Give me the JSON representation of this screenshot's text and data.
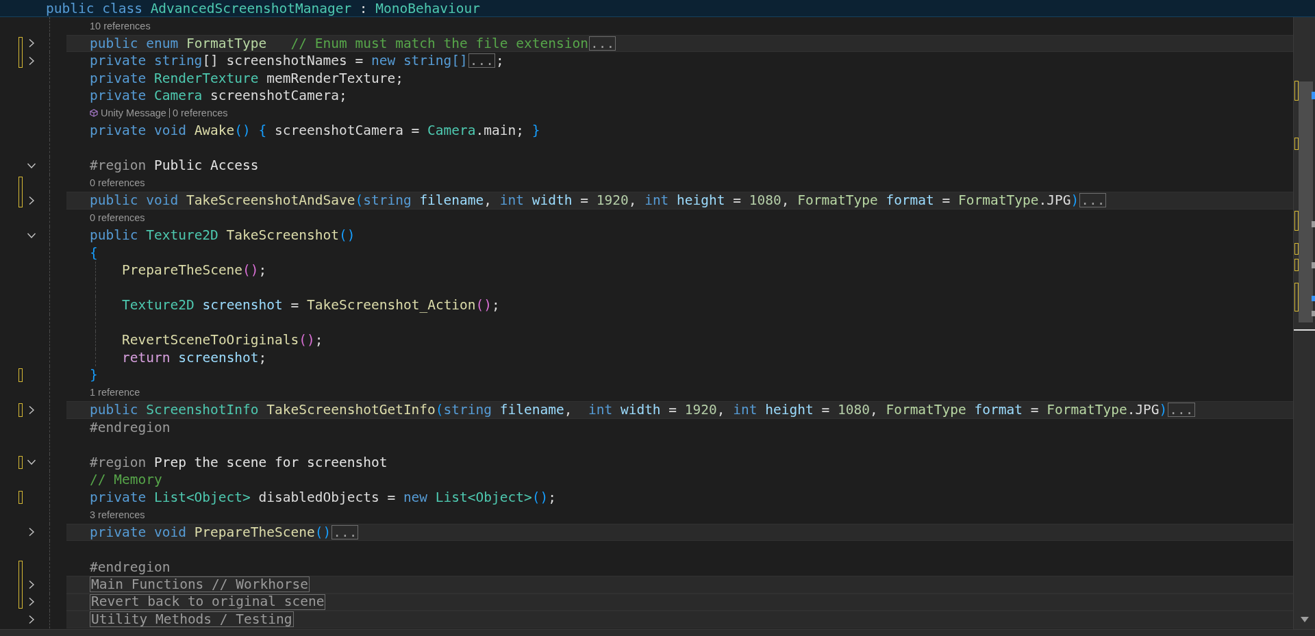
{
  "sticky_line": {
    "tokens": [
      {
        "kind": "kw",
        "text": "public class "
      },
      {
        "kind": "type",
        "text": "AdvancedScreenshotManager"
      },
      {
        "kind": "txt",
        "text": " : "
      },
      {
        "kind": "type",
        "text": "MonoBehaviour"
      }
    ]
  },
  "rows": [
    {
      "kind": "lens",
      "items": [
        "10 references"
      ]
    },
    {
      "kind": "code",
      "collapsed": true,
      "changed": true,
      "highlighted": true,
      "tokens": [
        {
          "kind": "kw",
          "text": "public enum "
        },
        {
          "kind": "enum",
          "text": "FormatType   "
        },
        {
          "kind": "cmt",
          "text": "// Enum must match the file extension"
        },
        {
          "kind": "ell",
          "text": "..."
        }
      ]
    },
    {
      "kind": "code",
      "collapsed": true,
      "changed": true,
      "tokens": [
        {
          "kind": "kw",
          "text": "private string"
        },
        {
          "kind": "txt",
          "text": "[] screenshotNames = "
        },
        {
          "kind": "kw",
          "text": "new string[]"
        },
        {
          "kind": "ell",
          "text": "..."
        },
        {
          "kind": "txt",
          "text": ";"
        }
      ]
    },
    {
      "kind": "code",
      "changed": false,
      "tokens": [
        {
          "kind": "kw",
          "text": "private "
        },
        {
          "kind": "type",
          "text": "RenderTexture"
        },
        {
          "kind": "txt",
          "text": " memRenderTexture;"
        }
      ]
    },
    {
      "kind": "code",
      "changed": false,
      "tokens": [
        {
          "kind": "kw",
          "text": "private "
        },
        {
          "kind": "type",
          "text": "Camera"
        },
        {
          "kind": "txt",
          "text": " screenshotCamera;"
        }
      ]
    },
    {
      "kind": "messagelens",
      "items": [
        "Unity Message",
        "0 references"
      ]
    },
    {
      "kind": "code",
      "changed": false,
      "tokens": [
        {
          "kind": "kw",
          "text": "private void "
        },
        {
          "kind": "fn",
          "text": "Awake"
        },
        {
          "kind": "b1",
          "text": "() {"
        },
        {
          "kind": "txt",
          "text": " screenshotCamera = "
        },
        {
          "kind": "type",
          "text": "Camera"
        },
        {
          "kind": "txt",
          "text": ".main; "
        },
        {
          "kind": "b1",
          "text": "}"
        }
      ]
    },
    {
      "kind": "blank",
      "changed": false
    },
    {
      "kind": "code",
      "collapsed": false,
      "changed": false,
      "tokens": [
        {
          "kind": "pre",
          "text": "#region "
        },
        {
          "kind": "reg",
          "text": "Public Access"
        }
      ]
    },
    {
      "kind": "lens",
      "changed": true,
      "items": [
        "0 references"
      ]
    },
    {
      "kind": "code",
      "collapsed": true,
      "changed": true,
      "highlighted": true,
      "tokens": [
        {
          "kind": "kw",
          "text": "public void "
        },
        {
          "kind": "fn",
          "text": "TakeScreenshotAndSave"
        },
        {
          "kind": "b1",
          "text": "("
        },
        {
          "kind": "kw",
          "text": "string "
        },
        {
          "kind": "var",
          "text": "filename"
        },
        {
          "kind": "txt",
          "text": ", "
        },
        {
          "kind": "kw",
          "text": "int "
        },
        {
          "kind": "var",
          "text": "width"
        },
        {
          "kind": "txt",
          "text": " = "
        },
        {
          "kind": "num",
          "text": "1920"
        },
        {
          "kind": "txt",
          "text": ", "
        },
        {
          "kind": "kw",
          "text": "int "
        },
        {
          "kind": "var",
          "text": "height"
        },
        {
          "kind": "txt",
          "text": " = "
        },
        {
          "kind": "num",
          "text": "1080"
        },
        {
          "kind": "txt",
          "text": ", "
        },
        {
          "kind": "enum",
          "text": "FormatType "
        },
        {
          "kind": "var",
          "text": "format"
        },
        {
          "kind": "txt",
          "text": " = "
        },
        {
          "kind": "enum",
          "text": "FormatType"
        },
        {
          "kind": "txt",
          "text": ".JPG"
        },
        {
          "kind": "b1",
          "text": ")"
        },
        {
          "kind": "ell",
          "text": "..."
        }
      ]
    },
    {
      "kind": "lens",
      "changed": false,
      "items": [
        "0 references"
      ]
    },
    {
      "kind": "code",
      "collapsed": false,
      "changed": false,
      "tokens": [
        {
          "kind": "kw",
          "text": "public "
        },
        {
          "kind": "type",
          "text": "Texture2D "
        },
        {
          "kind": "fn",
          "text": "TakeScreenshot"
        },
        {
          "kind": "b1",
          "text": "()"
        }
      ]
    },
    {
      "kind": "code",
      "changed": false,
      "tokens": [
        {
          "kind": "b1",
          "text": "{"
        }
      ]
    },
    {
      "kind": "code",
      "block": true,
      "changed": false,
      "tokens": [
        {
          "kind": "fn",
          "text": "PrepareTheScene"
        },
        {
          "kind": "b2",
          "text": "()"
        },
        {
          "kind": "txt",
          "text": ";"
        }
      ]
    },
    {
      "kind": "blank",
      "block": true,
      "changed": false
    },
    {
      "kind": "code",
      "block": true,
      "changed": false,
      "tokens": [
        {
          "kind": "type",
          "text": "Texture2D "
        },
        {
          "kind": "var",
          "text": "screenshot"
        },
        {
          "kind": "txt",
          "text": " = "
        },
        {
          "kind": "fn",
          "text": "TakeScreenshot_Action"
        },
        {
          "kind": "b2",
          "text": "()"
        },
        {
          "kind": "txt",
          "text": ";"
        }
      ]
    },
    {
      "kind": "blank",
      "block": true,
      "changed": false
    },
    {
      "kind": "code",
      "block": true,
      "changed": false,
      "tokens": [
        {
          "kind": "fn",
          "text": "RevertSceneToOriginals"
        },
        {
          "kind": "b2",
          "text": "()"
        },
        {
          "kind": "txt",
          "text": ";"
        }
      ]
    },
    {
      "kind": "code",
      "block": true,
      "changed": false,
      "tokens": [
        {
          "kind": "ctl",
          "text": "return "
        },
        {
          "kind": "var",
          "text": "screenshot"
        },
        {
          "kind": "txt",
          "text": ";"
        }
      ]
    },
    {
      "kind": "code",
      "changed": true,
      "tokens": [
        {
          "kind": "b1",
          "text": "}"
        }
      ]
    },
    {
      "kind": "lens",
      "changed": false,
      "items": [
        "1 reference"
      ]
    },
    {
      "kind": "code",
      "collapsed": true,
      "changed": true,
      "highlighted": true,
      "tokens": [
        {
          "kind": "kw",
          "text": "public "
        },
        {
          "kind": "type",
          "text": "ScreenshotInfo "
        },
        {
          "kind": "fn",
          "text": "TakeScreenshotGetInfo"
        },
        {
          "kind": "b1",
          "text": "("
        },
        {
          "kind": "kw",
          "text": "string "
        },
        {
          "kind": "var",
          "text": "filename"
        },
        {
          "kind": "txt",
          "text": ",  "
        },
        {
          "kind": "kw",
          "text": "int "
        },
        {
          "kind": "var",
          "text": "width"
        },
        {
          "kind": "txt",
          "text": " = "
        },
        {
          "kind": "num",
          "text": "1920"
        },
        {
          "kind": "txt",
          "text": ", "
        },
        {
          "kind": "kw",
          "text": "int "
        },
        {
          "kind": "var",
          "text": "height"
        },
        {
          "kind": "txt",
          "text": " = "
        },
        {
          "kind": "num",
          "text": "1080"
        },
        {
          "kind": "txt",
          "text": ", "
        },
        {
          "kind": "enum",
          "text": "FormatType "
        },
        {
          "kind": "var",
          "text": "format"
        },
        {
          "kind": "txt",
          "text": " = "
        },
        {
          "kind": "enum",
          "text": "FormatType"
        },
        {
          "kind": "txt",
          "text": ".JPG"
        },
        {
          "kind": "b1",
          "text": ")"
        },
        {
          "kind": "ell",
          "text": "..."
        }
      ]
    },
    {
      "kind": "code",
      "changed": false,
      "tokens": [
        {
          "kind": "pre",
          "text": "#endregion"
        }
      ]
    },
    {
      "kind": "blank",
      "changed": false
    },
    {
      "kind": "code",
      "collapsed": false,
      "changed": true,
      "tokens": [
        {
          "kind": "pre",
          "text": "#region "
        },
        {
          "kind": "reg",
          "text": "Prep the scene for screenshot"
        }
      ]
    },
    {
      "kind": "code",
      "changed": false,
      "tokens": [
        {
          "kind": "cmt",
          "text": "// Memory"
        }
      ]
    },
    {
      "kind": "code",
      "changed": true,
      "tokens": [
        {
          "kind": "kw",
          "text": "private "
        },
        {
          "kind": "type",
          "text": "List<Object>"
        },
        {
          "kind": "txt",
          "text": " disabledObjects = "
        },
        {
          "kind": "kw",
          "text": "new "
        },
        {
          "kind": "type",
          "text": "List<Object>"
        },
        {
          "kind": "b1",
          "text": "()"
        },
        {
          "kind": "txt",
          "text": ";"
        }
      ]
    },
    {
      "kind": "lens",
      "changed": false,
      "items": [
        "3 references"
      ]
    },
    {
      "kind": "code",
      "collapsed": true,
      "changed": false,
      "highlighted": true,
      "tokens": [
        {
          "kind": "kw",
          "text": "private void "
        },
        {
          "kind": "fn",
          "text": "PrepareTheScene"
        },
        {
          "kind": "b1",
          "text": "()"
        },
        {
          "kind": "ell",
          "text": "..."
        }
      ]
    },
    {
      "kind": "blank",
      "changed": false
    },
    {
      "kind": "code",
      "changed": true,
      "tokens": [
        {
          "kind": "pre",
          "text": "#endregion"
        }
      ]
    },
    {
      "kind": "region",
      "collapsed": true,
      "changed": true,
      "highlighted": true,
      "label": "Main Functions // Workhorse"
    },
    {
      "kind": "region",
      "collapsed": true,
      "changed": true,
      "highlighted": true,
      "label": "Revert back to original scene"
    },
    {
      "kind": "region",
      "collapsed": true,
      "changed": false,
      "highlighted": true,
      "label": "Utility Methods / Testing"
    }
  ]
}
